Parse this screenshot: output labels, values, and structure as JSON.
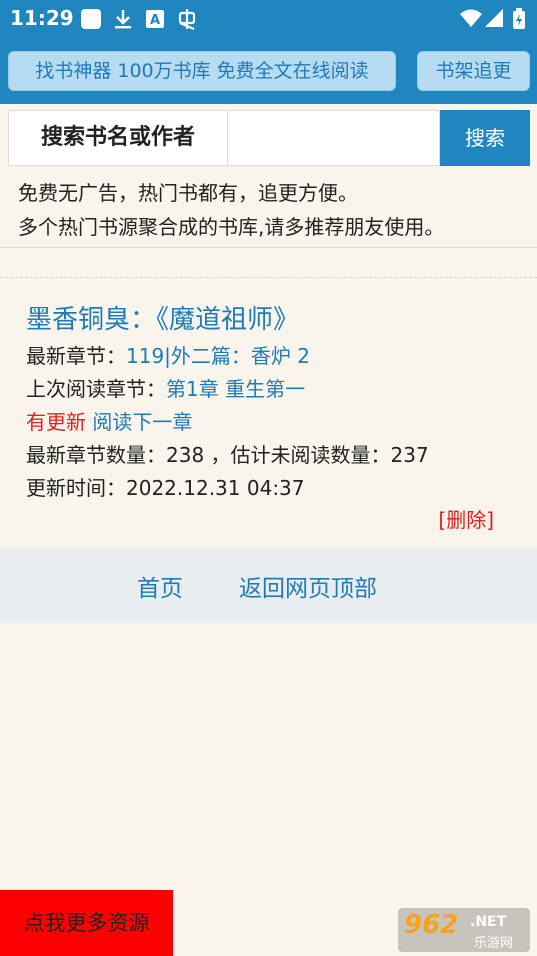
{
  "status_bar": {
    "time": "11:29",
    "icons": [
      "notification-square-icon",
      "download-icon",
      "app-a-icon",
      "bug-icon",
      "wifi-icon",
      "signal-icon",
      "battery-icon"
    ]
  },
  "header": {
    "slogan_button": "找书神器 100万书库 免费全文在线阅读",
    "bookshelf_button": "书架追更"
  },
  "search": {
    "label": "搜索书名或作者",
    "input_value": "",
    "button": "搜索"
  },
  "intro": {
    "line1": "免费无广告，热门书都有，追更方便。",
    "line2": "多个热门书源聚合成的书库,请多推荐朋友使用。"
  },
  "book": {
    "title": "墨香铜臭：《魔道祖师》",
    "latest_label": "最新章节：",
    "latest_value": "119|外二篇：香炉 2",
    "last_read_label": "上次阅读章节：",
    "last_read_value": "第1章 重生第一",
    "update_flag": "有更新",
    "read_next": "阅读下一章",
    "counts": "最新章节数量：238 ，估计未阅读数量：237",
    "update_time": "更新时间：2022.12.31 04:37",
    "delete": "[删除]"
  },
  "footer_nav": {
    "home": "首页",
    "back_to_top": "返回网页顶部"
  },
  "more_button": "点我更多资源",
  "watermark": {
    "number": "962",
    "net": ".NET",
    "text": "乐游网"
  },
  "colors": {
    "header_blue": "#1f86c0",
    "link_blue": "#1f7ab8",
    "alert_red": "#e02020",
    "background": "#f9f5ec",
    "more_button_red": "#ff0000"
  }
}
